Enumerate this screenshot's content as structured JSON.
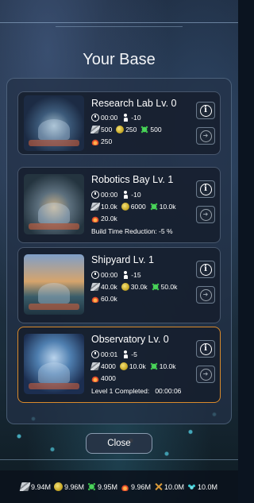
{
  "title": "Your Base",
  "buildings": [
    {
      "name": "Research Lab Lv. 0",
      "time": "00:00",
      "workers": "-10",
      "metal": "500",
      "gold": "250",
      "bio": "500",
      "energy": "250",
      "extra": ""
    },
    {
      "name": "Robotics Bay Lv. 1",
      "time": "00:00",
      "workers": "-10",
      "metal": "10.0k",
      "gold": "6000",
      "bio": "10.0k",
      "energy": "20.0k",
      "extra": "Build Time Reduction: -5 %"
    },
    {
      "name": "Shipyard Lv. 1",
      "time": "00:00",
      "workers": "-15",
      "metal": "40.0k",
      "gold": "30.0k",
      "bio": "50.0k",
      "energy": "60.0k",
      "extra": ""
    },
    {
      "name": "Observatory Lv. 0",
      "time": "00:01",
      "workers": "-5",
      "metal": "4000",
      "gold": "10.0k",
      "bio": "10.0k",
      "energy": "4000",
      "extra": "Level 1 Completed:   00:00:06"
    }
  ],
  "close_label": "Close",
  "resources": {
    "metal": "9.94M",
    "gold": "9.96M",
    "bio": "9.95M",
    "energy": "9.96M",
    "military": "10.0M",
    "crystal": "10.0M"
  },
  "colors": {
    "active_border": "#d98a2b",
    "panel": "#232f46"
  }
}
